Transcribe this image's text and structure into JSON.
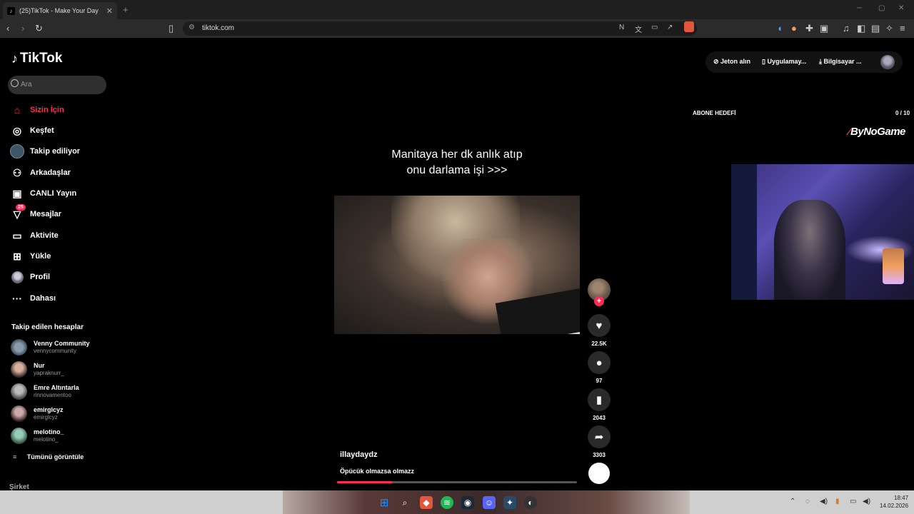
{
  "browser": {
    "tab_title": "(25)TikTok - Make Your Day",
    "tab_close": "✕",
    "new_tab": "+",
    "url": "tiktok.com"
  },
  "sidebar": {
    "logo": "TikTok",
    "search_placeholder": "Ara",
    "nav": [
      {
        "label": "Sizin İçin",
        "icon": "home-icon",
        "active": true
      },
      {
        "label": "Keşfet",
        "icon": "compass-icon"
      },
      {
        "label": "Takip ediliyor",
        "icon": "following-avatar-icon"
      },
      {
        "label": "Arkadaşlar",
        "icon": "friends-icon"
      },
      {
        "label": "CANLI Yayın",
        "icon": "live-tv-icon"
      },
      {
        "label": "Mesajlar",
        "icon": "messages-icon",
        "badge": "25"
      },
      {
        "label": "Aktivite",
        "icon": "activity-icon"
      },
      {
        "label": "Yükle",
        "icon": "upload-icon"
      },
      {
        "label": "Profil",
        "icon": "profile-icon"
      },
      {
        "label": "Dahası",
        "icon": "more-icon"
      }
    ],
    "following_title": "Takip edilen hesaplar",
    "accounts": [
      {
        "name": "Venny Community",
        "handle": "vennycommunity"
      },
      {
        "name": "Nur",
        "handle": "yapraknurr_"
      },
      {
        "name": "Emre Altıntarla",
        "handle": "rinnovamentoo"
      },
      {
        "name": "emirglcyz",
        "handle": "emirglcyz"
      },
      {
        "name": "melotino_",
        "handle": "melotino_"
      }
    ],
    "see_all": "Tümünü görüntüle",
    "footer": "Şirket"
  },
  "top_actions": {
    "coins": "Jeton alın",
    "app": "Uygulamay...",
    "desktop": "Bilgisayar ..."
  },
  "video": {
    "caption_line1": "Manitaya her dk anlık atıp",
    "caption_line2": "onu darlama işi >>>",
    "author": "illaydaydz",
    "description": "Öpücük olmazsa olmazz",
    "progress": 0.23,
    "likes": "22.5K",
    "comments": "97",
    "saves": "2043",
    "shares": "3303",
    "follow_plus": "+"
  },
  "stream_overlay": {
    "goal_title": "ABONE HEDEFİ",
    "goal_count": "0  / 10",
    "brand": "ByNoGame"
  },
  "taskbar": {
    "time": "18:47",
    "date": "14.02.2026"
  },
  "colors": {
    "accent": "#fe2c55",
    "background": "#000000"
  }
}
